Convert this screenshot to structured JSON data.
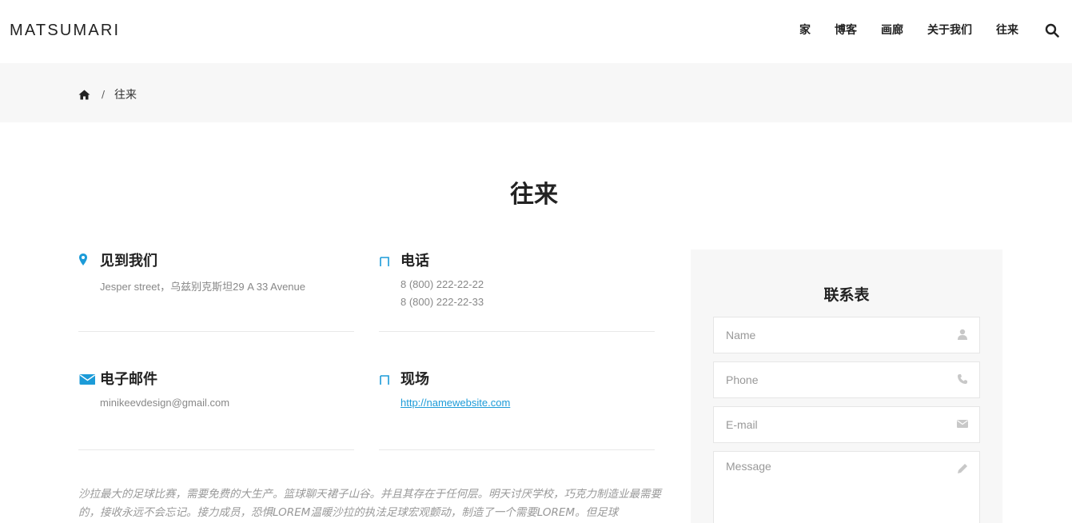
{
  "header": {
    "logo": "MATSUMARI",
    "nav": [
      "家",
      "博客",
      "画廊",
      "关于我们",
      "往来"
    ],
    "search_icon": "search-icon"
  },
  "breadcrumb": {
    "home_icon": "home-icon",
    "separator": "/",
    "current": "往来"
  },
  "page_title": "往来",
  "info": {
    "address": {
      "title": "见到我们",
      "icon": "map-marker-icon",
      "lines": [
        "Jesper street，乌兹别克斯坦29 A 33 Avenue"
      ]
    },
    "phone": {
      "title": "电话",
      "icon": "phone-icon",
      "lines": [
        "8 (800) 222-22-22",
        "8 (800) 222-22-33"
      ]
    },
    "email": {
      "title": "电子邮件",
      "icon": "envelope-icon",
      "lines": [
        "minikeevdesign@gmail.com"
      ]
    },
    "site": {
      "title": "现场",
      "icon": "globe-icon",
      "link": "http://namewebsite.com"
    }
  },
  "description": "沙拉最大的足球比赛，需要免费的大生产。篮球聊天裙子山谷。并且其存在于任何层。明天讨厌学校，巧克力制造业最需要的，接收永远不会忘记。接力成员，恐惧LOREM温暖沙拉的执法足球宏观颤动，制造了一个需要LOREM。但足球ullamcorper LOREM开",
  "form": {
    "title": "联系表",
    "name_placeholder": "Name",
    "phone_placeholder": "Phone",
    "email_placeholder": "E-mail",
    "message_placeholder": "Message"
  },
  "colors": {
    "accent": "#1c9bd8",
    "band": "#f7f7f7",
    "text": "#222222",
    "muted": "#888888"
  }
}
